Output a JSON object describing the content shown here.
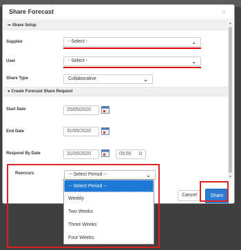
{
  "modal": {
    "title": "Share Forecast",
    "close": "×"
  },
  "share_setup": {
    "header": "Share Setup",
    "supplier_label": "Supplier",
    "supplier_value": "- Select -",
    "user_label": "User",
    "user_value": "- Select -",
    "share_type_label": "Share Type",
    "share_type_value": "Collaborative"
  },
  "request": {
    "header": "Create Forecast Share Request",
    "start_date_label": "Start Date",
    "start_date_value": "25/05/2020",
    "end_date_label": "End Date",
    "end_date_value": "31/05/2020",
    "respond_label": "Respond By Date",
    "respond_date_value": "31/05/2020",
    "respond_time_value": "09:00",
    "reoccurs_label": "Reoccurs",
    "reoccurs_value": "-- Select Period --"
  },
  "dropdown": {
    "options": [
      "-- Select Period --",
      "Weekly",
      "Two Weeks",
      "Three Weeks",
      "Four Weeks"
    ]
  },
  "footer": {
    "cancel": "Cancel",
    "share": "Share"
  },
  "colors": {
    "highlight": "#e02020",
    "primary": "#2b7cd3",
    "selected": "#1e78d6"
  }
}
